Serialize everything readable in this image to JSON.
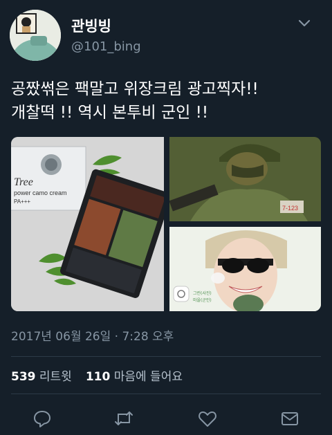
{
  "header": {
    "display_name": "관빙빙",
    "handle": "@101_bing"
  },
  "tweet": {
    "line1": "공짰썪은 팩말고 위장크림 광고찍자!!",
    "line2": "개찰떡 !! 역시 본투비 군인 !!"
  },
  "media": {
    "product_brand": "Tree",
    "product_text": "power camo cream",
    "product_sub": "PA+++",
    "soldier_tag": "7-123",
    "watermark_lines": [
      "그린(사진)",
      "마을(군인)"
    ]
  },
  "meta": {
    "timestamp": "2017년 06월 26일 · 7:28 오후"
  },
  "stats": {
    "retweets_count": "539",
    "retweets_label": "리트윗",
    "likes_count": "110",
    "likes_label": "마음에 들어요"
  },
  "icons": [
    "reply-icon",
    "retweet-icon",
    "like-icon",
    "message-icon",
    "chevron-down-icon"
  ],
  "colors": {
    "background": "#151f29",
    "secondary_text": "#8796a4",
    "divider": "#2c3a47"
  }
}
